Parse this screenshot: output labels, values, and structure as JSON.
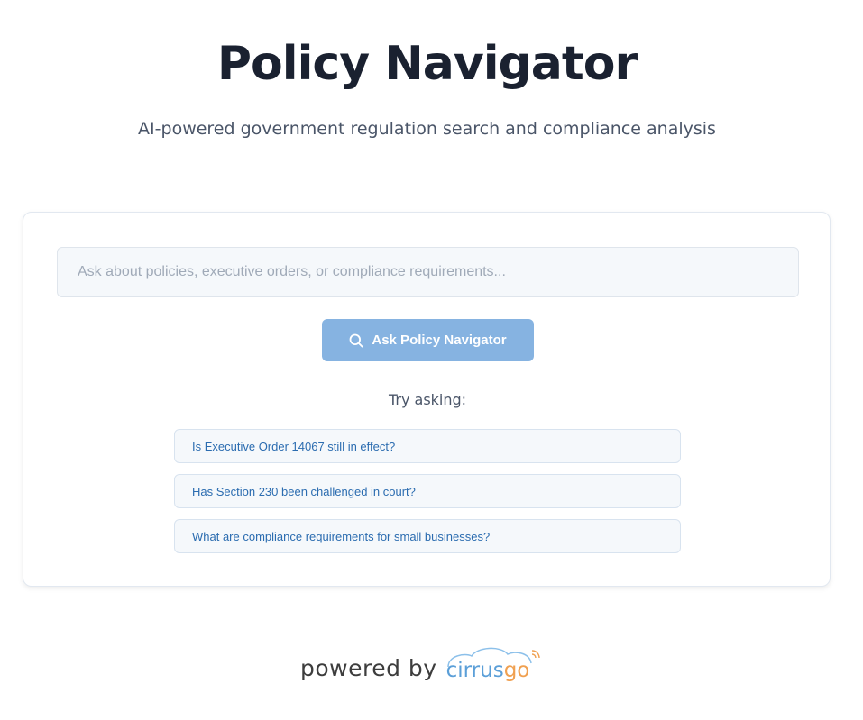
{
  "header": {
    "title": "Policy Navigator",
    "subtitle": "AI-powered government regulation search and compliance analysis"
  },
  "search": {
    "placeholder": "Ask about policies, executive orders, or compliance requirements...",
    "value": "",
    "button_label": "Ask Policy Navigator",
    "button_icon": "search-icon"
  },
  "suggestions": {
    "label": "Try asking:",
    "items": [
      "Is Executive Order 14067 still in effect?",
      "Has Section 230 been challenged in court?",
      "What are compliance requirements for small businesses?"
    ]
  },
  "footer": {
    "powered_by": "powered by",
    "brand_part1": "cirrus",
    "brand_part2": "go"
  },
  "colors": {
    "title": "#1a2130",
    "button": "#86b3e1",
    "suggestion_text": "#2b6cb0",
    "brand_blue": "#5b9fd8",
    "brand_orange": "#f0a050"
  }
}
